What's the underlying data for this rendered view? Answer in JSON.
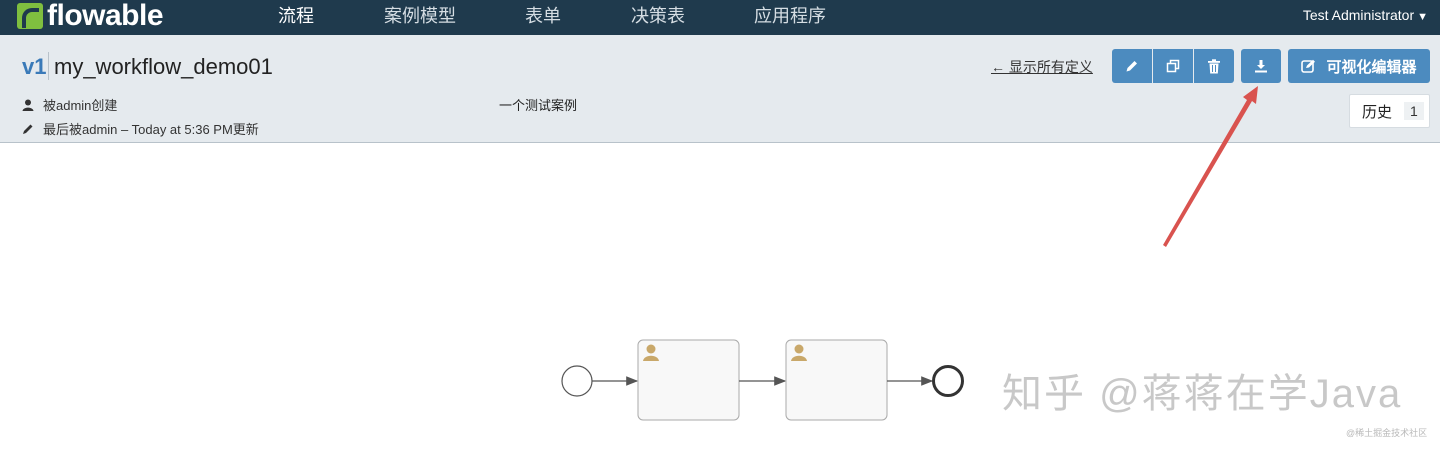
{
  "nav": {
    "logo_text": "flowable",
    "items": [
      {
        "label": "流程",
        "active": true
      },
      {
        "label": "案例模型",
        "active": false
      },
      {
        "label": "表单",
        "active": false
      },
      {
        "label": "决策表",
        "active": false
      },
      {
        "label": "应用程序",
        "active": false
      }
    ],
    "user": "Test Administrator"
  },
  "header": {
    "version": "v1",
    "model_name": "my_workflow_demo01",
    "created_by": "被admin创建",
    "updated": "最后被admin – Today at 5:36 PM更新",
    "description": "一个测试案例",
    "show_all_link": "← 显示所有定义",
    "visual_editor_label": "可视化编辑器",
    "history_label": "历史",
    "history_count": "1"
  },
  "toolbar_icons": {
    "edit": "pencil-icon",
    "copy": "copy-icon",
    "delete": "trash-icon",
    "download": "download-icon",
    "visual_editor": "edit-square-icon"
  },
  "colors": {
    "nav_bg": "#1f3a4d",
    "accent": "#4c8bbf",
    "header_bg": "#e5eaee",
    "annotation": "#d9534f",
    "task_icon": "#c9a86a"
  },
  "watermark": {
    "main": "知乎 @蒋蒋在学Java",
    "small": "@稀土掘金技术社区"
  }
}
